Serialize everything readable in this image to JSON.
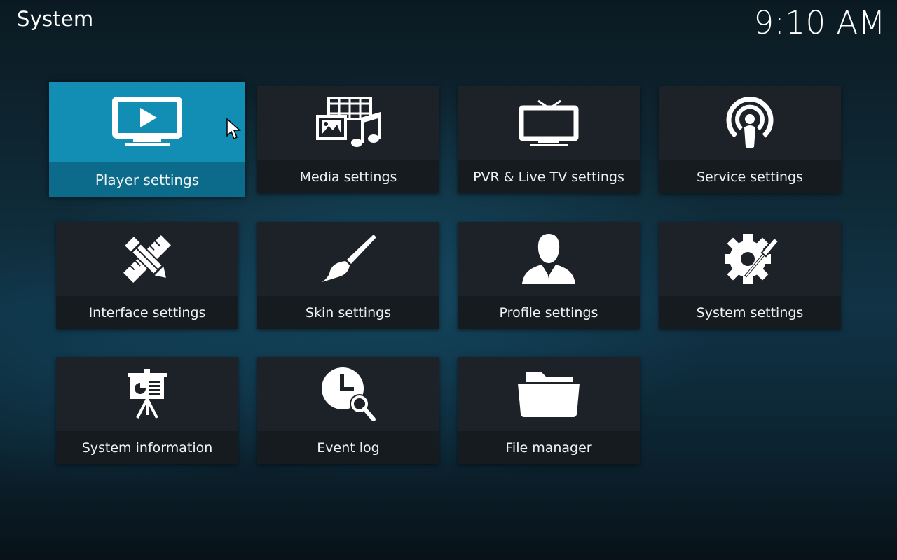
{
  "header": {
    "title": "System",
    "clock": "9:10 AM"
  },
  "tiles": [
    {
      "label": "Player settings",
      "icon": "monitor-play-icon"
    },
    {
      "label": "Media settings",
      "icon": "media-icon"
    },
    {
      "label": "PVR & Live TV settings",
      "icon": "tv-icon"
    },
    {
      "label": "Service settings",
      "icon": "broadcast-icon"
    },
    {
      "label": "Interface settings",
      "icon": "pencil-ruler-icon"
    },
    {
      "label": "Skin settings",
      "icon": "paintbrush-icon"
    },
    {
      "label": "Profile settings",
      "icon": "user-icon"
    },
    {
      "label": "System settings",
      "icon": "gear-screwdriver-icon"
    },
    {
      "label": "System information",
      "icon": "presentation-board-icon"
    },
    {
      "label": "Event log",
      "icon": "clock-search-icon"
    },
    {
      "label": "File manager",
      "icon": "folder-icon"
    }
  ],
  "focused_tile": "Player settings",
  "colors": {
    "focus": "#128db4",
    "focus_label_bar": "#0c6b8a",
    "tile": "#1c2227"
  }
}
